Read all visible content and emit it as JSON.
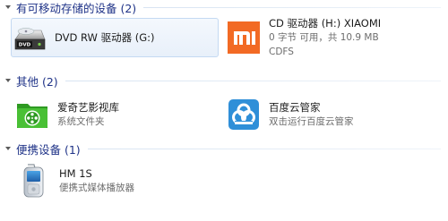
{
  "groups": {
    "drives": {
      "title": "有可移动存储的设备 (2)"
    },
    "other": {
      "title": "其他 (2)"
    },
    "portable": {
      "title": "便携设备 (1)"
    }
  },
  "items": {
    "dvd": {
      "name": "DVD RW 驱动器 (G:)",
      "icon_text": "DVD",
      "icon": "dvd-drive-icon"
    },
    "cd": {
      "name": "CD 驱动器 (H:) XIAOMI",
      "space": "0 字节 可用，共 10.9 MB",
      "fs": "CDFS",
      "icon": "xiaomi-logo-icon",
      "icon_text": "mi",
      "color": "#f26a24"
    },
    "iqiyi": {
      "name": "爱奇艺影视库",
      "sub": "系统文件夹",
      "icon": "iqiyi-library-icon",
      "color": "#3cb82b"
    },
    "baidu": {
      "name": "百度云管家",
      "sub": "双击运行百度云管家",
      "icon": "baidu-cloud-icon",
      "color": "#2f8fd8"
    },
    "hm": {
      "name": "HM 1S",
      "sub": "便携式媒体播放器",
      "icon": "mobile-phone-icon"
    }
  },
  "colors": {
    "header_text": "#1e3287",
    "selection_border": "#c4d9f2"
  }
}
